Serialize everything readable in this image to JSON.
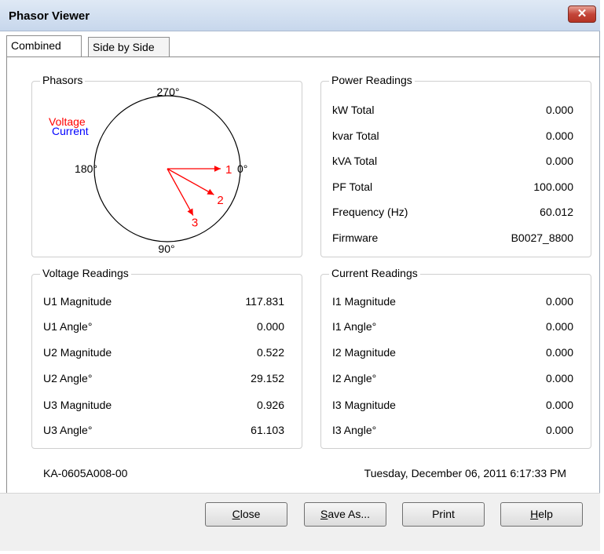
{
  "window": {
    "title": "Phasor Viewer",
    "close_glyph": "✕"
  },
  "tabs": [
    {
      "label": "Combined",
      "active": true
    },
    {
      "label": "Side by Side",
      "active": false
    }
  ],
  "phasors": {
    "title": "Phasors",
    "legend": {
      "voltage": "Voltage",
      "current": "Current",
      "voltage_color": "#ff0000",
      "current_color": "#0000ff"
    },
    "axis_labels": {
      "top": "270°",
      "right": "0°",
      "left": "180°",
      "bottom": "90°"
    },
    "vectors": [
      {
        "label": "1",
        "angle": 0.0,
        "length": 1.0
      },
      {
        "label": "2",
        "angle": 29.152,
        "length": 1.0
      },
      {
        "label": "3",
        "angle": 61.103,
        "length": 1.0
      }
    ]
  },
  "power": {
    "title": "Power Readings",
    "rows": [
      {
        "label": "kW Total",
        "value": "0.000"
      },
      {
        "label": "kvar Total",
        "value": "0.000"
      },
      {
        "label": "kVA Total",
        "value": "0.000"
      },
      {
        "label": "PF Total",
        "value": "100.000"
      },
      {
        "label": "Frequency (Hz)",
        "value": "60.012"
      },
      {
        "label": "Firmware",
        "value": "B0027_8800"
      }
    ]
  },
  "voltage": {
    "title": "Voltage Readings",
    "rows": [
      {
        "label": "U1 Magnitude",
        "value": "117.831"
      },
      {
        "label": "U1 Angle°",
        "value": "0.000"
      },
      {
        "label": "U2 Magnitude",
        "value": "0.522"
      },
      {
        "label": "U2 Angle°",
        "value": "29.152"
      },
      {
        "label": "U3 Magnitude",
        "value": "0.926"
      },
      {
        "label": "U3 Angle°",
        "value": "61.103"
      }
    ]
  },
  "current": {
    "title": "Current Readings",
    "rows": [
      {
        "label": "I1 Magnitude",
        "value": "0.000"
      },
      {
        "label": "I1 Angle°",
        "value": "0.000"
      },
      {
        "label": "I2 Magnitude",
        "value": "0.000"
      },
      {
        "label": "I2 Angle°",
        "value": "0.000"
      },
      {
        "label": "I3 Magnitude",
        "value": "0.000"
      },
      {
        "label": "I3 Angle°",
        "value": "0.000"
      }
    ]
  },
  "footer": {
    "device_id": "KA-0605A008-00",
    "timestamp": "Tuesday, December 06, 2011 6:17:33 PM"
  },
  "buttons": {
    "close": {
      "mnemonic": "C",
      "rest": "lose"
    },
    "save_as": {
      "mnemonic": "S",
      "rest": "ave As..."
    },
    "print": {
      "label": "Print"
    },
    "help": {
      "mnemonic": "H",
      "rest": "elp"
    }
  }
}
